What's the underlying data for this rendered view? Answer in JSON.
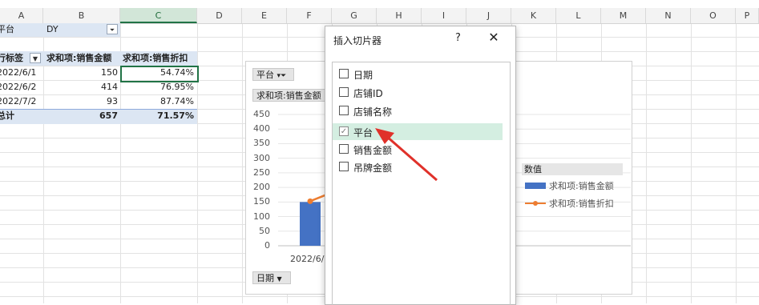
{
  "columns": [
    "A",
    "B",
    "C",
    "D",
    "E",
    "F",
    "G",
    "H",
    "I",
    "J",
    "K",
    "L",
    "M",
    "N",
    "O",
    "P"
  ],
  "filter_row": {
    "label": "平台",
    "value": "DY"
  },
  "pivot": {
    "headers": [
      "行标签",
      "求和项:销售金额",
      "求和项:销售折扣"
    ],
    "rows": [
      {
        "label": "2022/6/1",
        "amount": "150",
        "discount": "54.74%"
      },
      {
        "label": "2022/6/2",
        "amount": "414",
        "discount": "76.95%"
      },
      {
        "label": "2022/7/2",
        "amount": "93",
        "discount": "87.74%"
      }
    ],
    "total": {
      "label": "总计",
      "amount": "657",
      "discount": "71.57%"
    }
  },
  "chart": {
    "filter_chip": "平台",
    "value_chip": "求和项:销售金额",
    "axis_chip": "日期",
    "x_label": "2022/6/1",
    "legend_title": "数值",
    "colors": {
      "bar": "#4472c4",
      "line": "#ed7d31"
    }
  },
  "chart_data": {
    "type": "bar",
    "categories": [
      "2022/6/1"
    ],
    "series": [
      {
        "name": "求和项:销售金额",
        "values": [
          150
        ]
      },
      {
        "name": "求和项:销售折扣",
        "values": [
          0.5474
        ]
      }
    ],
    "yticks": [
      "450",
      "400",
      "350",
      "300",
      "250",
      "200",
      "150",
      "100",
      "50",
      "0"
    ],
    "ylim": [
      0,
      450
    ],
    "legend": "right"
  },
  "dialog": {
    "title": "插入切片器",
    "help": "?",
    "close": "✕",
    "items": [
      {
        "label": "日期",
        "checked": false
      },
      {
        "label": "店铺ID",
        "checked": false
      },
      {
        "label": "店铺名称",
        "checked": false
      },
      {
        "label": "平台",
        "checked": true
      },
      {
        "label": "销售金额",
        "checked": false
      },
      {
        "label": "吊牌金额",
        "checked": false
      }
    ]
  },
  "annotation_color": "#e0312a"
}
